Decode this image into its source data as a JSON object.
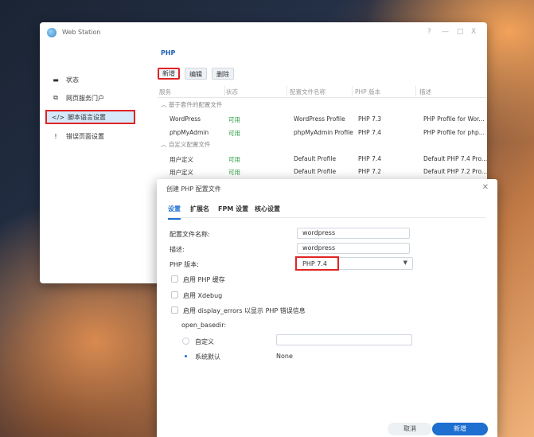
{
  "window": {
    "title": "Web Station",
    "controls": [
      "?",
      "—",
      "□",
      "X"
    ]
  },
  "sidebar": {
    "items": [
      {
        "label": "状态",
        "icon": "monitor-icon",
        "glyph": "▬"
      },
      {
        "label": "网页服务门户",
        "icon": "portal-icon",
        "glyph": "⧉"
      },
      {
        "label": "脚本语言设置",
        "icon": "code-icon",
        "glyph": "</>"
      },
      {
        "label": "错误页面设置",
        "icon": "error-page-icon",
        "glyph": "!"
      }
    ]
  },
  "main": {
    "section_title": "PHP",
    "toolbar": {
      "create": "新增",
      "edit": "编辑",
      "delete": "删除"
    },
    "columns": [
      "服务",
      "状态",
      "配置文件名称",
      "PHP 版本",
      "描述"
    ],
    "groups": [
      {
        "label": "基于套件的配置文件",
        "rows": [
          [
            "WordPress",
            "可用",
            "WordPress Profile",
            "PHP 7.3",
            "PHP Profile for Wor..."
          ],
          [
            "phpMyAdmin",
            "可用",
            "phpMyAdmin Profile",
            "PHP 7.4",
            "PHP Profile for php..."
          ]
        ]
      },
      {
        "label": "自定义配置文件",
        "rows": [
          [
            "用户定义",
            "可用",
            "Default Profile",
            "PHP 7.4",
            "Default PHP 7.4 Pro..."
          ],
          [
            "用户定义",
            "可用",
            "Default Profile",
            "PHP 7.2",
            "Default PHP 7.2 Pro..."
          ]
        ]
      }
    ]
  },
  "dialog": {
    "title": "创建 PHP 配置文件",
    "tabs": [
      "设置",
      "扩展名",
      "FPM 设置",
      "核心设置"
    ],
    "fields": {
      "profile_name_label": "配置文件名称:",
      "profile_name_value": "wordpress",
      "desc_label": "描述:",
      "desc_value": "wordpress",
      "php_version_label": "PHP 版本:",
      "php_version_value": "PHP 7.4"
    },
    "checkboxes": [
      "启用 PHP 缓存",
      "启用 Xdebug",
      "启用 display_errors 以显示 PHP 错误信息"
    ],
    "open_basedir_label": "open_basedir:",
    "radio_custom": "自定义",
    "radio_default": "系统默认",
    "default_value": "None",
    "cancel": "取消",
    "create": "新增"
  },
  "colors": {
    "accent": "#1e6fd0",
    "highlight": "#e02424",
    "ok": "#2ea043"
  }
}
